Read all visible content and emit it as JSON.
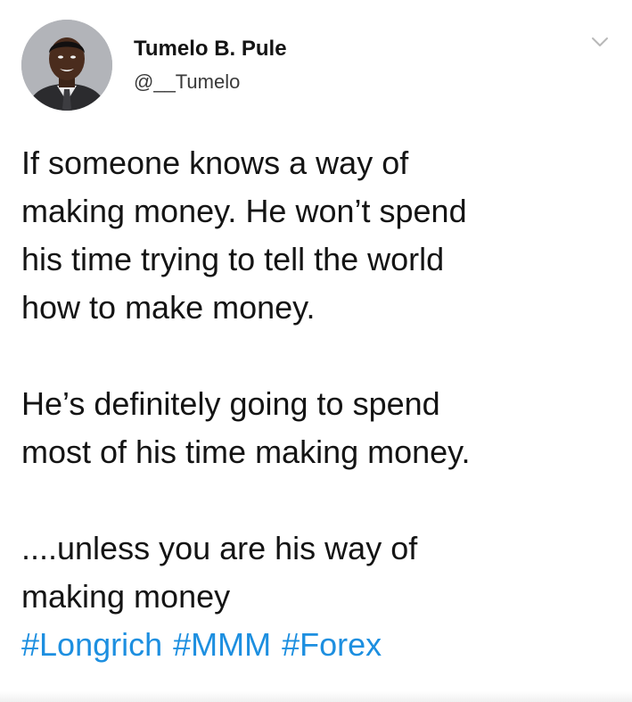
{
  "tweet": {
    "author": {
      "display_name": "Tumelo B. Pule",
      "handle": "@__Tumelo",
      "avatar_icon": "profile-photo"
    },
    "menu_icon": "chevron-down-icon",
    "paragraphs": [
      "If someone knows a way of\nmaking money. He won’t spend\nhis time trying to tell the world\nhow to make money.",
      "He’s definitely going to spend\nmost of his time making money.",
      "....unless you are his way of\nmaking money"
    ],
    "hashtags": [
      "#Longrich",
      "#MMM",
      "#Forex"
    ],
    "colors": {
      "text": "#141414",
      "hashtag": "#1d8fe0",
      "handle": "#3a3a3a"
    }
  }
}
